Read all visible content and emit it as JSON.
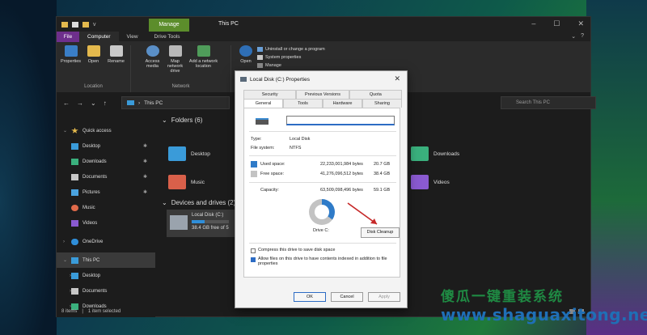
{
  "explorer": {
    "title": "This PC",
    "manage_tab": "Manage",
    "tabs": [
      "File",
      "Computer",
      "View",
      "Drive Tools"
    ],
    "ribbon": {
      "location_group": "Location",
      "network_group": "Network",
      "btn_properties": "Properties",
      "btn_open": "Open",
      "btn_rename": "Rename",
      "btn_access_media": "Access media",
      "btn_map_drive": "Map network drive",
      "btn_add_location": "Add a network location",
      "btn_open2": "Open",
      "sys_uninstall": "Uninstall or change a program",
      "sys_properties": "System properties",
      "sys_manage": "Manage"
    },
    "address": "This PC",
    "search_placeholder": "Search This PC",
    "nav": {
      "quick_access": "Quick access",
      "desktop": "Desktop",
      "downloads": "Downloads",
      "documents": "Documents",
      "pictures": "Pictures",
      "music": "Music",
      "videos": "Videos",
      "onedrive": "OneDrive",
      "this_pc": "This PC",
      "desktop2": "Desktop",
      "documents2": "Documents",
      "downloads2": "Downloads"
    },
    "content": {
      "folders_header": "Folders (6)",
      "devices_header": "Devices and drives (2)",
      "desktop": "Desktop",
      "music": "Music",
      "downloads": "Downloads",
      "videos": "Videos",
      "drive_name": "Local Disk (C:)",
      "drive_free": "38.4 GB free of 5",
      "drive_used_fraction": 0.35
    },
    "status": {
      "items": "8 items",
      "selected": "1 item selected"
    }
  },
  "dialog": {
    "title": "Local Disk (C:) Properties",
    "tabs_top": [
      "Security",
      "Previous Versions",
      "Quota"
    ],
    "tabs_bottom": [
      "General",
      "Tools",
      "Hardware",
      "Sharing"
    ],
    "name_value": "",
    "type_label": "Type:",
    "type_value": "Local Disk",
    "fs_label": "File system:",
    "fs_value": "NTFS",
    "used_label": "Used space:",
    "used_bytes": "22,233,001,984 bytes",
    "used_gb": "20.7 GB",
    "free_label": "Free space:",
    "free_bytes": "41,276,096,512 bytes",
    "free_gb": "38.4 GB",
    "cap_label": "Capacity:",
    "cap_bytes": "63,509,098,496 bytes",
    "cap_gb": "59.1 GB",
    "drive_label": "Drive C:",
    "cleanup_btn": "Disk Cleanup",
    "compress_label": "Compress this drive to save disk space",
    "index_label": "Allow files on this drive to have contents indexed in addition to file properties",
    "ok": "OK",
    "cancel": "Cancel",
    "apply": "Apply",
    "used_fraction": 0.35
  },
  "watermark": {
    "chinese": "傻瓜一键重装系统",
    "url": "www.shaguaxitong.net"
  }
}
